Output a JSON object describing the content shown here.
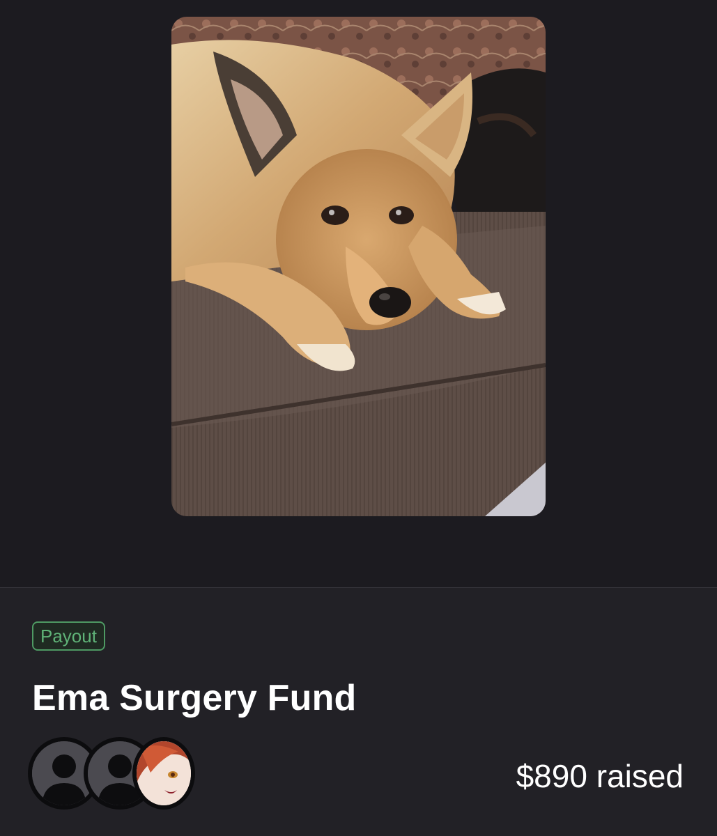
{
  "campaign": {
    "badge": "Payout",
    "title": "Ema Surgery Fund",
    "raised": "$890 raised",
    "photo_subject": "dog-photo"
  },
  "donors": [
    {
      "type": "placeholder",
      "icon": "person-icon"
    },
    {
      "type": "placeholder",
      "icon": "person-icon"
    },
    {
      "type": "image",
      "icon": "anime-avatar"
    }
  ],
  "colors": {
    "background": "#1f1e23",
    "badge_green": "#5fb277",
    "text": "#ffffff"
  }
}
